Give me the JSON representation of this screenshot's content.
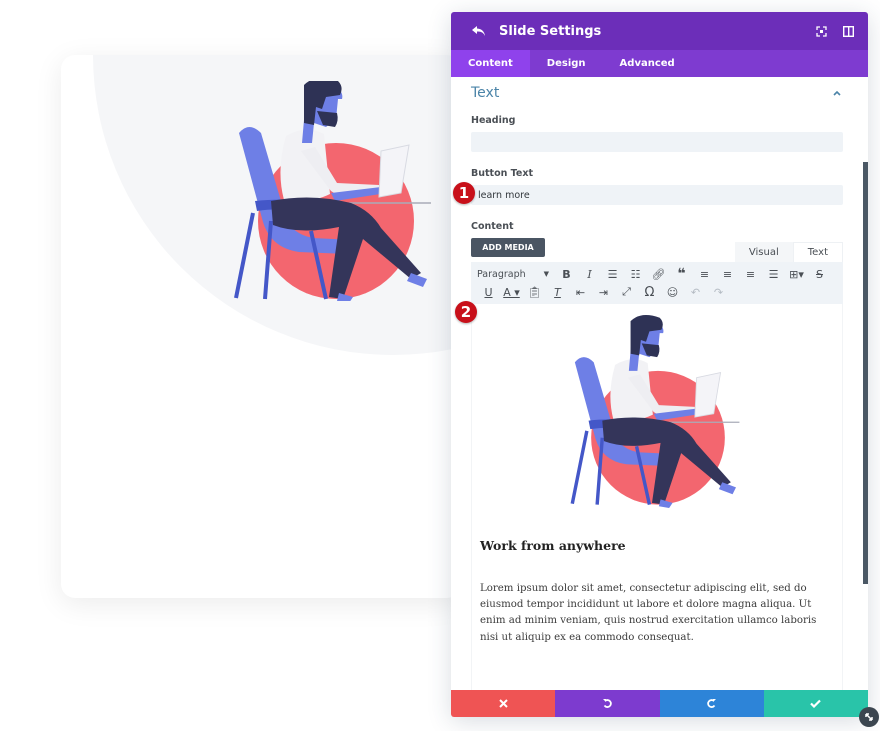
{
  "modal": {
    "title": "Slide Settings",
    "tabs": [
      {
        "label": "Content",
        "active": true
      },
      {
        "label": "Design",
        "active": false
      },
      {
        "label": "Advanced",
        "active": false
      }
    ],
    "header_icons": [
      "back-arrow-icon",
      "focus-icon",
      "sidebar-toggle-icon"
    ]
  },
  "section": {
    "title": "Text",
    "fields": {
      "heading": {
        "label": "Heading",
        "value": ""
      },
      "button_text": {
        "label": "Button Text",
        "value": "learn more"
      },
      "content": {
        "label": "Content"
      }
    }
  },
  "editor": {
    "add_media_label": "ADD MEDIA",
    "tabs": [
      {
        "label": "Visual",
        "active": true
      },
      {
        "label": "Text",
        "active": false
      }
    ],
    "format_select": "Paragraph",
    "toolbar_row1": [
      "bold",
      "italic",
      "bullet-list",
      "numbered-list",
      "link",
      "blockquote",
      "align-left",
      "align-center",
      "align-right",
      "align-justify",
      "table",
      "strikethrough"
    ],
    "toolbar_row2": [
      "underline",
      "text-color",
      "paste-text",
      "clear-formatting",
      "outdent",
      "indent",
      "fullscreen",
      "special-character",
      "emoji",
      "undo",
      "redo"
    ],
    "content_heading": "Work from anywhere",
    "content_paragraph": "Lorem ipsum dolor sit amet, consectetur adipiscing elit, sed do eiusmod tempor incididunt ut labore et dolore magna aliqua. Ut enim ad minim veniam, quis nostrud exercitation ullamco laboris nisi ut aliquip ex ea commodo consequat."
  },
  "footer": {
    "buttons": [
      {
        "name": "cancel",
        "icon": "✖",
        "color": "#ef5454"
      },
      {
        "name": "undo",
        "icon": "↺",
        "color": "#7d3bcf"
      },
      {
        "name": "redo",
        "icon": "↻",
        "color": "#2d84d8"
      },
      {
        "name": "save",
        "icon": "✔",
        "color": "#29c4a9"
      }
    ]
  },
  "badges": [
    "1",
    "2"
  ],
  "colors": {
    "header": "#6c2eb9",
    "tabs": "#7e3bd0",
    "active_tab": "#8f42ec",
    "section_title": "#4b84a8",
    "illustration_circle": "#f3666f",
    "illustration_chair": "#6e7fe6",
    "illustration_pants": "#34355a"
  }
}
